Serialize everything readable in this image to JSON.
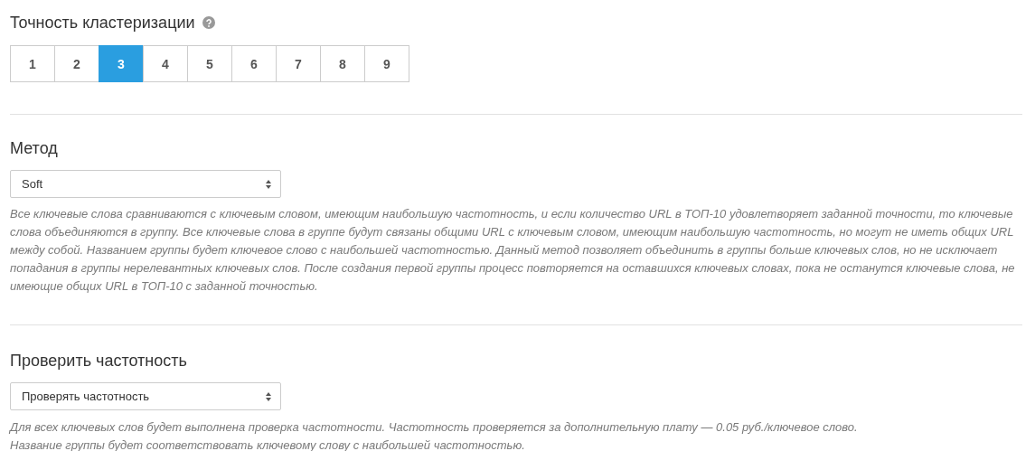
{
  "precision": {
    "title": "Точность кластеризации",
    "options": [
      {
        "label": "1",
        "selected": false
      },
      {
        "label": "2",
        "selected": false
      },
      {
        "label": "3",
        "selected": true
      },
      {
        "label": "4",
        "selected": false
      },
      {
        "label": "5",
        "selected": false
      },
      {
        "label": "6",
        "selected": false
      },
      {
        "label": "7",
        "selected": false
      },
      {
        "label": "8",
        "selected": false
      },
      {
        "label": "9",
        "selected": false
      }
    ]
  },
  "method": {
    "title": "Метод",
    "value": "Soft",
    "description": [
      "Все ключевые слова сравниваются с ключевым словом, имеющим наибольшую частотность, и если количество URL в ТОП-10 удовлетворяет заданной точности, то ключевые слова объединяются в группу. Все ключевые слова в группе будут связаны общими URL с ключевым словом, имеющим наибольшую частотность, но могут не иметь общих URL между собой. Названием группы будет ключевое слово с наибольшей частотностью. Данный метод позволяет объединить в группы больше ключевых слов, но не исключает попадания в группы нерелевантных ключевых слов. После создания первой группы процесс повторяется на оставшихся ключевых словах, пока не останутся ключевые слова, не имеющие общих URL в ТОП-10 с заданной точностью."
    ]
  },
  "frequency": {
    "title": "Проверить частотность",
    "value": "Проверять частотность",
    "description": [
      "Для всех ключевых слов будет выполнена проверка частотности. Частотность проверяется за дополнительную плату — 0.05 руб./ключевое слово.",
      "Название группы будет соответствовать ключевому слову с наибольшей частотностью."
    ]
  }
}
